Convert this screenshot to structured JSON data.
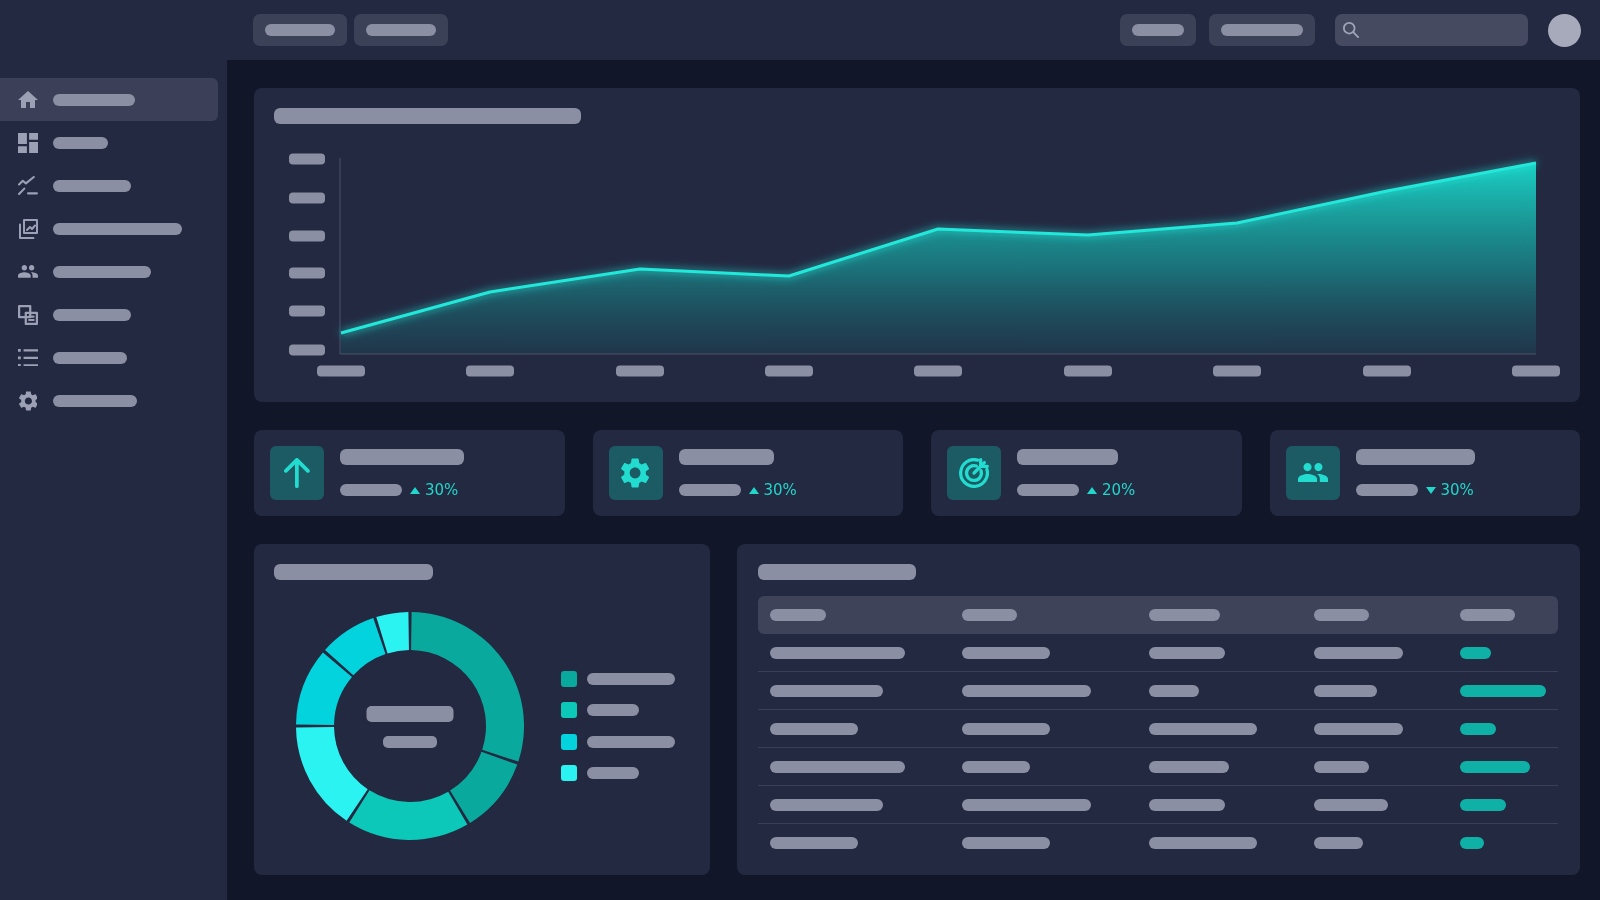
{
  "sidebar": {
    "items": [
      {
        "selected": true
      },
      {
        "selected": false
      },
      {
        "selected": false
      },
      {
        "selected": false
      },
      {
        "selected": false
      },
      {
        "selected": false
      },
      {
        "selected": false
      },
      {
        "selected": false
      }
    ]
  },
  "stats": [
    {
      "rising": true,
      "change": "30%"
    },
    {
      "rising": true,
      "change": "30%"
    },
    {
      "rising": true,
      "change": "20%"
    },
    {
      "rising": false,
      "change": "30%"
    }
  ],
  "donut": {
    "legend": [
      {
        "color": "#0aa99e"
      },
      {
        "color": "#0cc8b8"
      },
      {
        "color": "#02d3dd"
      },
      {
        "color": "#2bf3f2"
      }
    ]
  }
}
